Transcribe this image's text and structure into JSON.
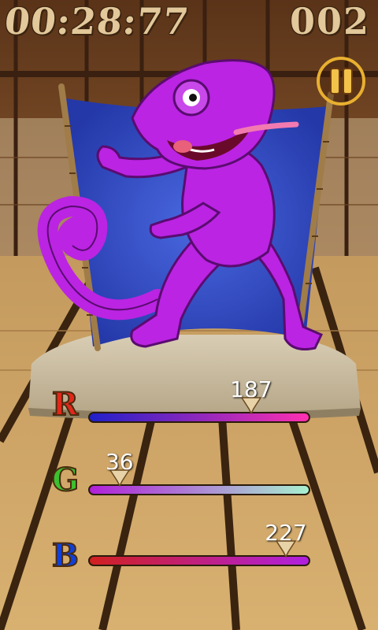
{
  "hud": {
    "timer": "00:28:77",
    "score": "002"
  },
  "pause": {
    "icon": "pause-icon"
  },
  "sliders": {
    "r": {
      "letter": "R",
      "value": "187",
      "level": 187,
      "max": 255,
      "gradient": [
        "#2020c8",
        "#ff30b0"
      ],
      "color": "#e0281a"
    },
    "g": {
      "letter": "G",
      "value": "36",
      "level": 36,
      "max": 255,
      "gradient": [
        "#b020d8",
        "#a8f0d0"
      ],
      "color": "#3cc030"
    },
    "b": {
      "letter": "B",
      "value": "227",
      "level": 227,
      "max": 255,
      "gradient": [
        "#d02020",
        "#b020e0"
      ],
      "color": "#1040d8"
    }
  },
  "chameleon_color": "#bb24e3"
}
